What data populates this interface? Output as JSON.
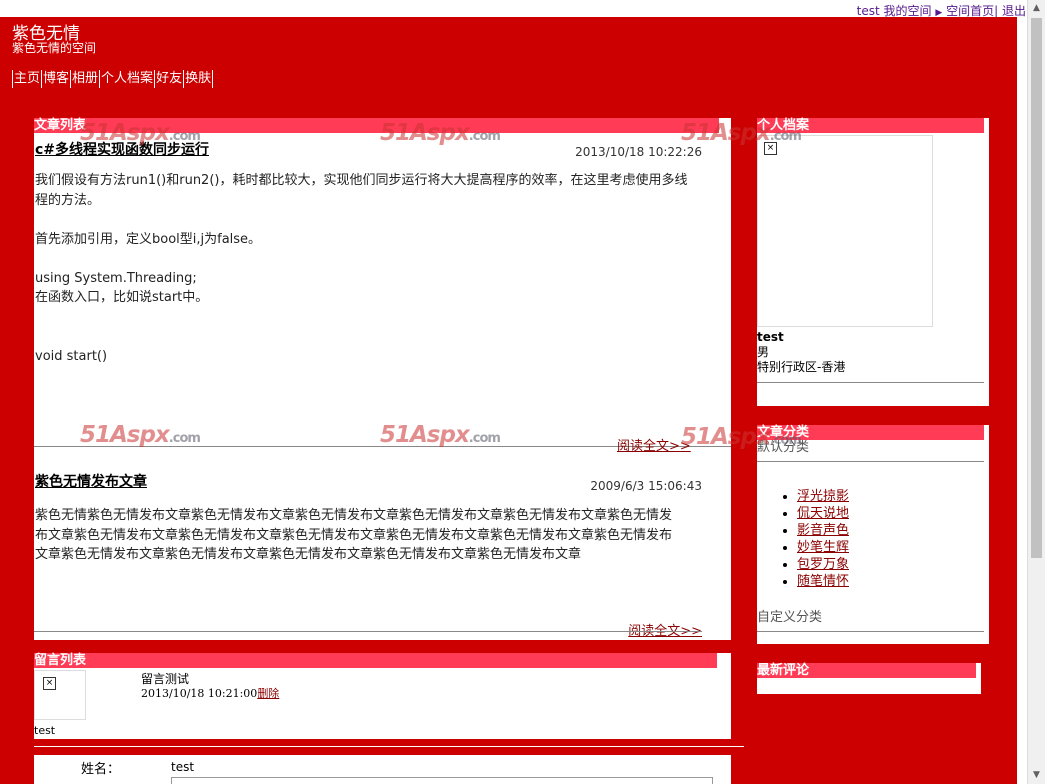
{
  "topbar": {
    "user": "test",
    "my_space": "我的空间",
    "home": "空间首页",
    "logout": "退出"
  },
  "site": {
    "title": "紫色无情",
    "subtitle": "紫色无情的空间"
  },
  "nav": [
    "主页",
    "博客",
    "相册",
    "个人档案",
    "好友",
    "换肤"
  ],
  "watermark": {
    "brand": "51Aspx",
    "suffix": ".com"
  },
  "articles_panel": {
    "heading": "文章列表"
  },
  "articles": [
    {
      "title": "c#多线程实现函数同步运行",
      "date": "2013/10/18 10:22:26",
      "body": [
        "我们假设有方法run1()和run2()，耗时都比较大，实现他们同步运行将大大提高程序的效率，在这里考虑使用多线程的方法。",
        "",
        "首先添加引用，定义bool型i,j为false。",
        "",
        "using System.Threading;",
        "在函数入口，比如说start中。",
        "",
        "",
        "void start()"
      ],
      "more": "阅读全文>>"
    },
    {
      "title": "紫色无情发布文章",
      "date": "2009/6/3 15:06:43",
      "body": [
        "紫色无情紫色无情发布文章紫色无情发布文章紫色无情发布文章紫色无情发布文章紫色无情发布文章紫色无情发布文章紫色无情发布文章紫色无情发布文章紫色无情发布文章紫色无情发布文章紫色无情发布文章紫色无情发布文章紫色无情发布文章紫色无情发布文章紫色无情发布文章紫色无情发布文章紫色无情发布文章"
      ],
      "more": "阅读全文>>"
    }
  ],
  "profile": {
    "heading": "个人档案",
    "name": "test",
    "gender": "男",
    "location": "特别行政区-香港"
  },
  "categories": {
    "heading": "文章分类",
    "default_label": "默认分类",
    "items": [
      "浮光掠影",
      "侃天说地",
      "影音声色",
      "妙笔生辉",
      "包罗万象",
      "随笔情怀"
    ],
    "custom_label": "自定义分类"
  },
  "comments": {
    "heading": "最新评论"
  },
  "messages": {
    "heading": "留言列表",
    "items": [
      {
        "user": "test",
        "text": "留言测试",
        "time": "2013/10/18 10:21:00",
        "delete": "删除"
      }
    ]
  },
  "form": {
    "name_label": "姓名：",
    "name_value": "test"
  }
}
